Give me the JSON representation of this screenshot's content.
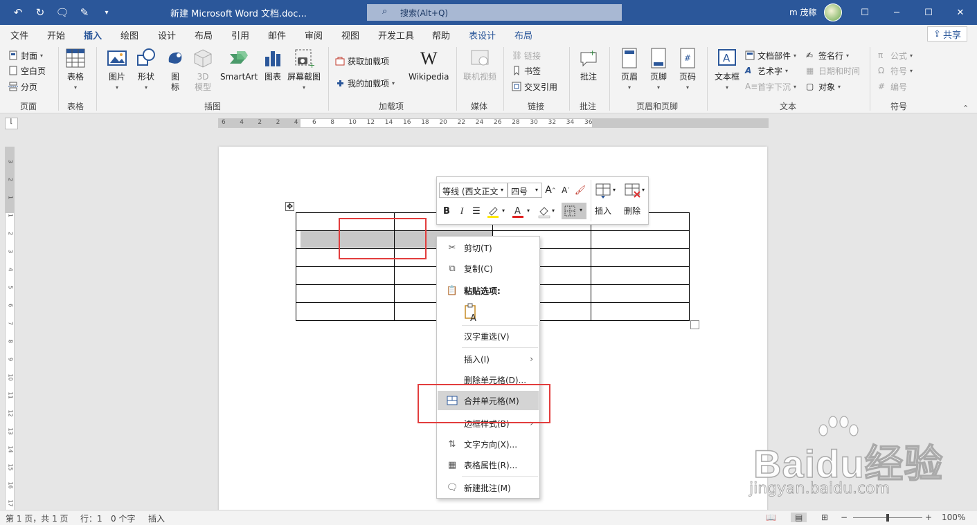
{
  "titlebar": {
    "doc_title": "新建 Microsoft Word 文档.doc... ",
    "search_placeholder": "搜索(Alt+Q)",
    "user_name": "m 茂稼",
    "minimize": "─",
    "restore": "☐",
    "maximize": "☐",
    "close": "✕"
  },
  "tabs": [
    "文件",
    "开始",
    "插入",
    "绘图",
    "设计",
    "布局",
    "引用",
    "邮件",
    "审阅",
    "视图",
    "开发工具",
    "帮助",
    "表设计",
    "布局"
  ],
  "active_tab": "插入",
  "share_label": "共享",
  "ribbon": {
    "pages": {
      "cover": "封面",
      "blank": "空白页",
      "break": "分页",
      "label": "页面"
    },
    "table": {
      "table": "表格",
      "label": "表格"
    },
    "illus": {
      "picture": "图片",
      "shape": "形状",
      "icon": "图标",
      "model3d": "3D 模型",
      "smartart": "SmartArt",
      "chart": "图表",
      "screenshot": "屏幕截图",
      "label": "插图"
    },
    "addins": {
      "get": "获取加载项",
      "my": "我的加载项",
      "wiki": "Wikipedia",
      "label": "加载项"
    },
    "media": {
      "video": "联机视频",
      "label": "媒体"
    },
    "links": {
      "link": "链接",
      "bookmark": "书签",
      "xref": "交叉引用",
      "label": "链接"
    },
    "comments": {
      "comment": "批注",
      "label": "批注"
    },
    "hf": {
      "header": "页眉",
      "footer": "页脚",
      "pagenum": "页码",
      "label": "页眉和页脚"
    },
    "text": {
      "textbox": "文本框",
      "parts": "文档部件",
      "wordart": "艺术字",
      "dropcap": "首字下沉",
      "sigline": "签名行",
      "datetime": "日期和时间",
      "object": "对象",
      "label": "文本"
    },
    "symbols": {
      "equation": "公式",
      "symbol": "符号",
      "number": "编号",
      "label": "符号"
    }
  },
  "minitoolbar": {
    "font": "等线 (西文正文",
    "size": "四号",
    "grow": "A",
    "shrink": "A",
    "bold": "B",
    "italic": "I",
    "insert_label": "插入",
    "delete_label": "删除"
  },
  "context_menu": {
    "cut": "剪切(T)",
    "copy": "复制(C)",
    "paste_options": "粘贴选项:",
    "hanzi": "汉字重选(V)",
    "insert": "插入(I)",
    "delete_cells": "删除单元格(D)...",
    "merge_cells": "合并单元格(M)",
    "border_styles": "边框样式(B)",
    "text_direction": "文字方向(X)...",
    "table_props": "表格属性(R)...",
    "new_comment": "新建批注(M)"
  },
  "status": {
    "page": "第 1 页，共 1 页",
    "line": "行：1",
    "words": "0 个字",
    "mode": "插入",
    "zoom": "100%"
  },
  "hruler_numbers": [
    "6",
    "4",
    "2",
    "2",
    "4",
    "6",
    "8",
    "10",
    "12",
    "14",
    "16",
    "18",
    "20",
    "22",
    "24",
    "26",
    "28",
    "30",
    "32",
    "34",
    "36"
  ],
  "vruler_numbers": [
    "3",
    "2",
    "1",
    "1",
    "2",
    "3",
    "4",
    "5",
    "6",
    "7",
    "8",
    "9",
    "10",
    "11",
    "12",
    "13",
    "14",
    "15",
    "16",
    "17"
  ],
  "watermark": {
    "brand": "Baidu经验",
    "url": "jingyan.baidu.com"
  },
  "colors": {
    "accent": "#2b579a",
    "highlight_red": "#e23d3d",
    "selection_gray": "#c8c8c8"
  }
}
